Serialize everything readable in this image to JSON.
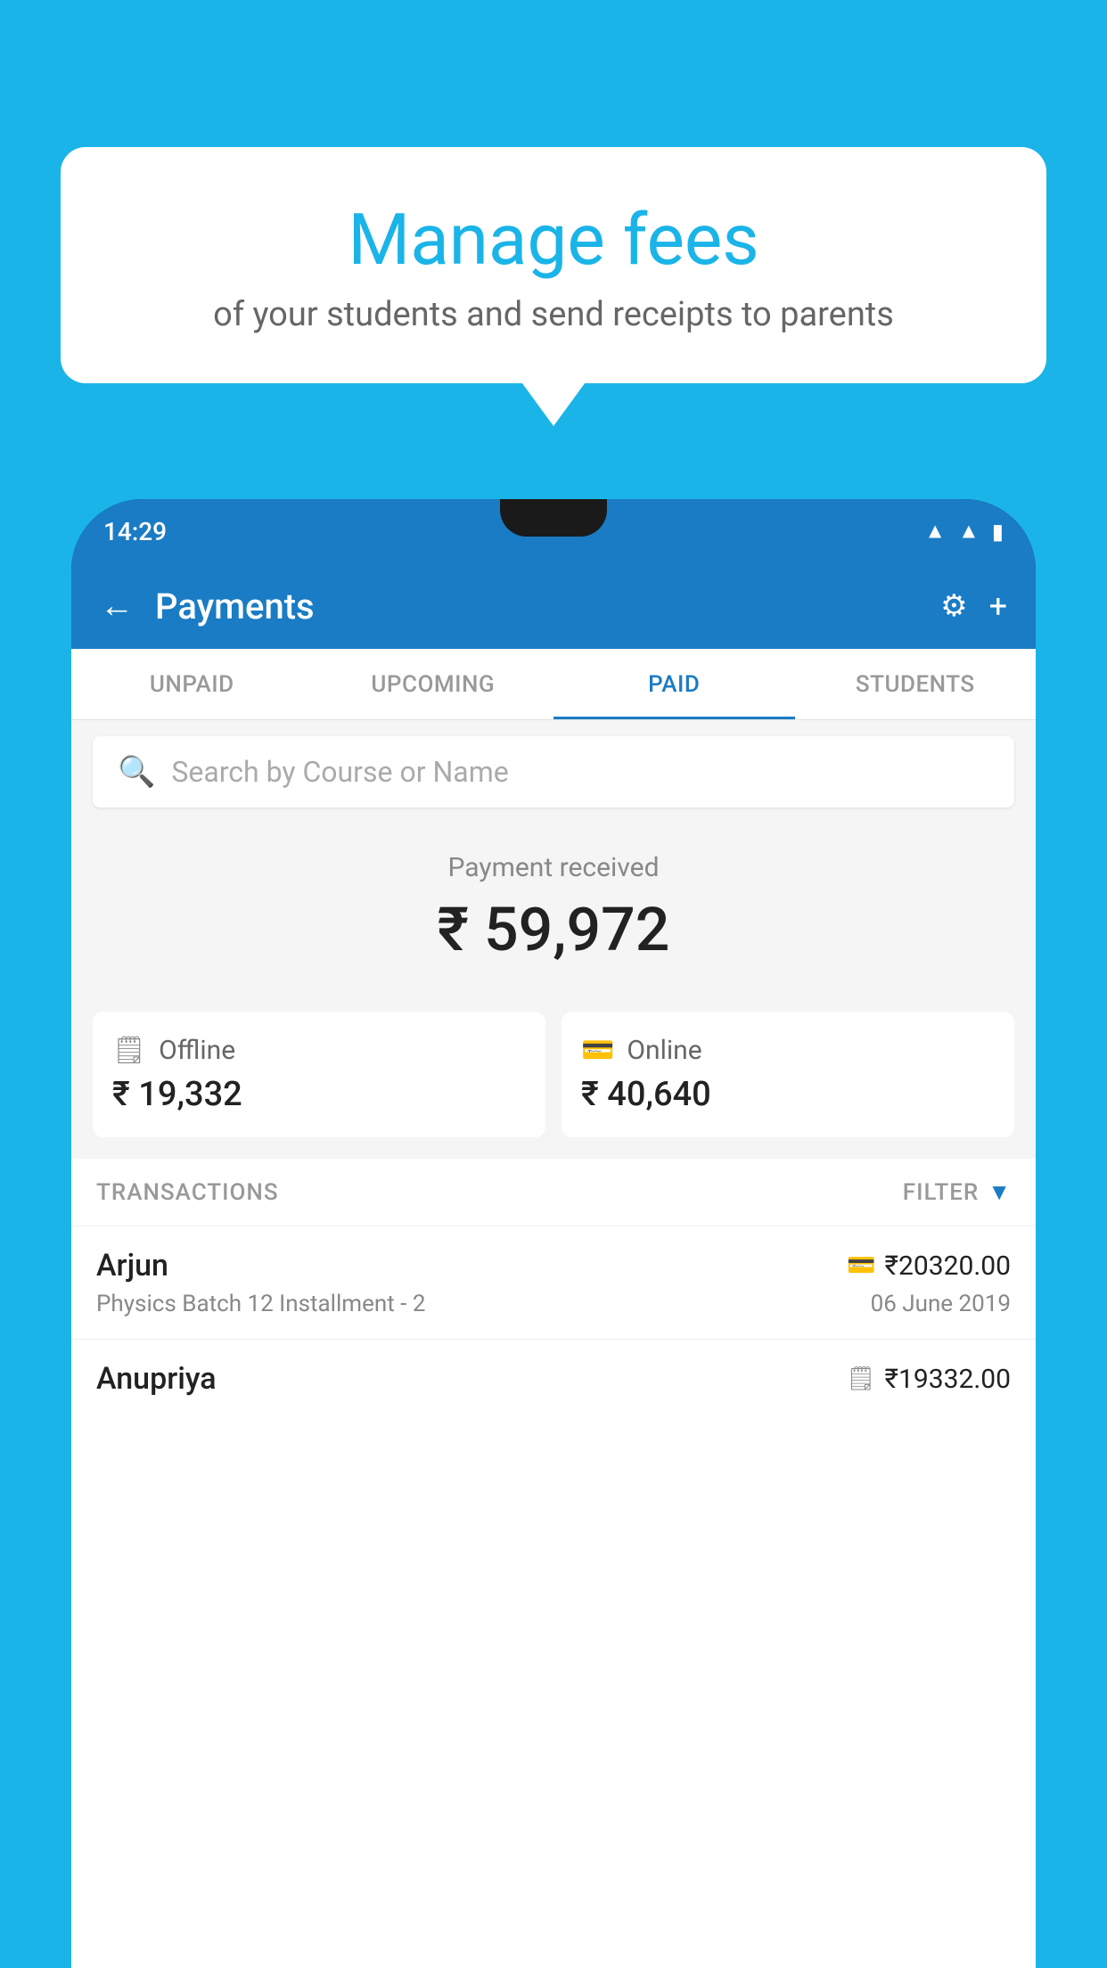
{
  "background_color": "#1ab4e8",
  "bubble": {
    "title": "Manage fees",
    "subtitle": "of your students and send receipts to parents"
  },
  "status_bar": {
    "time": "14:29",
    "icons": [
      "wifi",
      "signal",
      "battery"
    ]
  },
  "header": {
    "title": "Payments",
    "back_label": "←",
    "settings_label": "⚙",
    "add_label": "+"
  },
  "tabs": [
    {
      "label": "UNPAID",
      "active": false
    },
    {
      "label": "UPCOMING",
      "active": false
    },
    {
      "label": "PAID",
      "active": true
    },
    {
      "label": "STUDENTS",
      "active": false
    }
  ],
  "search": {
    "placeholder": "Search by Course or Name"
  },
  "payment_summary": {
    "label": "Payment received",
    "amount": "₹ 59,972",
    "offline": {
      "type": "Offline",
      "amount": "₹ 19,332"
    },
    "online": {
      "type": "Online",
      "amount": "₹ 40,640"
    }
  },
  "transactions": {
    "label": "TRANSACTIONS",
    "filter_label": "FILTER",
    "rows": [
      {
        "name": "Arjun",
        "course": "Physics Batch 12 Installment - 2",
        "amount": "₹20320.00",
        "date": "06 June 2019",
        "payment_type": "card"
      },
      {
        "name": "Anupriya",
        "course": "",
        "amount": "₹19332.00",
        "date": "",
        "payment_type": "cash"
      }
    ]
  }
}
